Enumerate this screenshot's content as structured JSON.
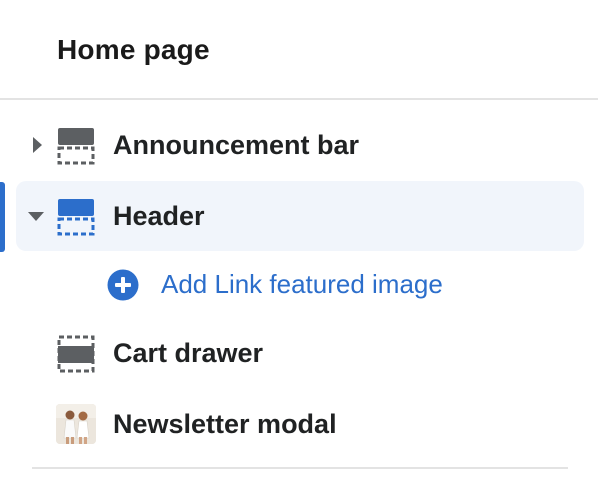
{
  "page": {
    "title": "Home page"
  },
  "sections": [
    {
      "label": "Announcement bar",
      "icon": "section-footer-icon",
      "expanded": false
    },
    {
      "label": "Header",
      "icon": "section-header-icon",
      "expanded": true,
      "selected": true
    },
    {
      "label": "Cart drawer",
      "icon": "section-bar-icon"
    },
    {
      "label": "Newsletter modal",
      "icon": "image-thumbnail"
    }
  ],
  "header_block": {
    "add_label": "Add Link featured image",
    "add_icon": "plus-circle-icon"
  },
  "colors": {
    "accent": "#2c6ecb",
    "selected_background": "#f1f5fb",
    "icon_gray": "#5c5f62",
    "divider": "#e3e3e3"
  }
}
